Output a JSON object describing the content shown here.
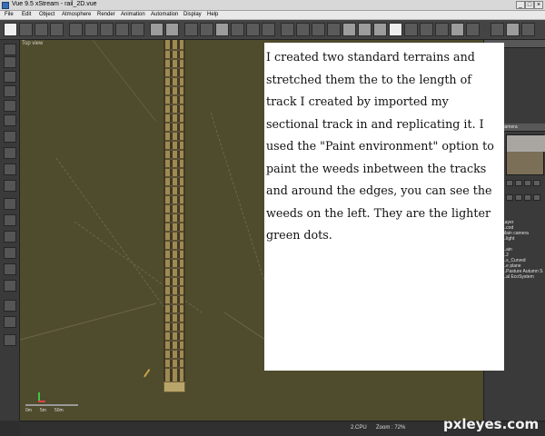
{
  "window": {
    "title": "Vue 9.5 xStream - rail_2D.vue",
    "minimize": "_",
    "maximize": "□",
    "close": "×"
  },
  "menubar": {
    "items": [
      "File",
      "Edit",
      "Object",
      "Atmosphere",
      "Render",
      "Animation",
      "Automation",
      "Display",
      "Help"
    ]
  },
  "viewport": {
    "label": "Top view",
    "scale": [
      "0m",
      "5m",
      "50m"
    ]
  },
  "right_panel": {
    "camera_label": "camera",
    "preview_label": "Main camera",
    "layers": [
      "Layer",
      "...cod",
      "Main camera",
      "...light",
      "",
      "...ain",
      "...2",
      "...s_Curved",
      "...e plane",
      "...Pasture Autumn S",
      "...al EcoSystem"
    ]
  },
  "overlay_text": "I created two standard terrains and stretched them the to the length of track I created by imported my sectional track in and replicating it.  I used the \"Paint environment\" option to paint the weeds inbetween the tracks and around the edges, you can see the weeds on the left. They are the lighter green dots.",
  "statusbar": {
    "dimension": "2.CPU",
    "zoom": "Zoom : 72%"
  },
  "watermark": "pxleyes.com"
}
